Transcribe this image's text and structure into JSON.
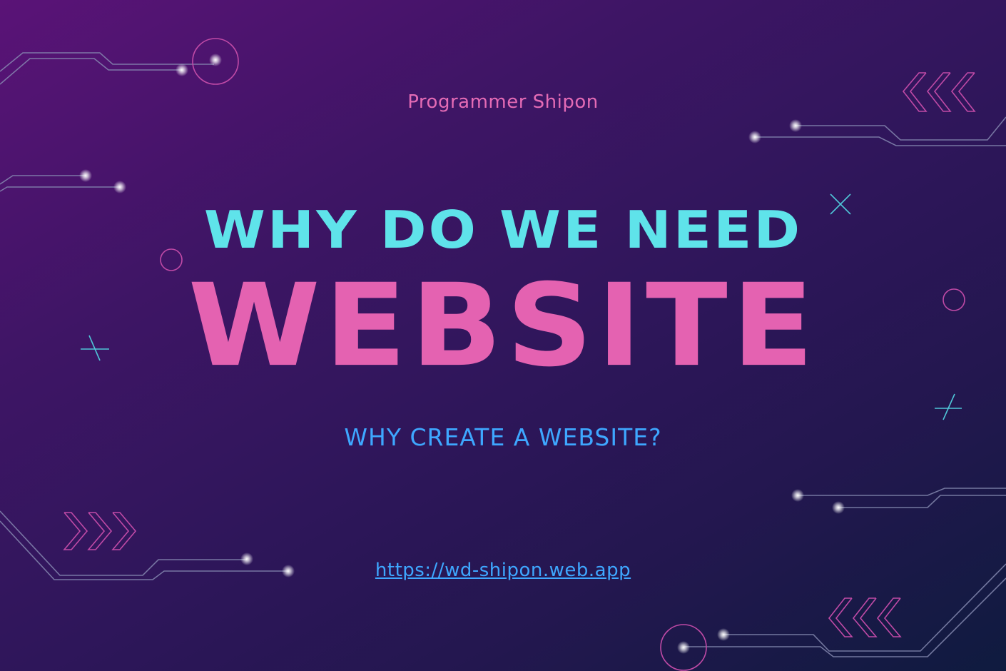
{
  "author": "Programmer Shipon",
  "headline": "WHY DO WE NEED",
  "big_word": "WEBSITE",
  "subheadline": "WHY CREATE A WEBSITE?",
  "link": {
    "text": "https://wd-shipon.web.app",
    "href": "https://wd-shipon.web.app"
  },
  "colors": {
    "background_start": "#5a1377",
    "background_end": "#0f1b3f",
    "cyan": "#5fe3ea",
    "pink": "#e462b1",
    "blue": "#3ea7ff",
    "line": "#8a8fb5"
  }
}
